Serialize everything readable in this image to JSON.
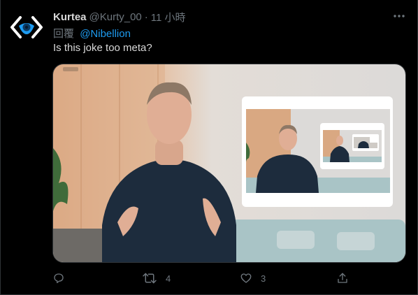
{
  "tweet": {
    "author_name": "Kurtea",
    "author_handle": "@Kurty_00",
    "separator": "·",
    "timestamp": "11 小時",
    "reply_prefix": "回覆",
    "reply_to": "@Nibellion",
    "text": "Is this joke too meta?",
    "media_icon": "recursive-video-frame-image"
  },
  "actions": {
    "reply_icon": "reply-icon",
    "retweet_icon": "retweet-icon",
    "retweet_count": "4",
    "like_icon": "heart-icon",
    "like_count": "3",
    "share_icon": "share-icon"
  },
  "colors": {
    "background": "#000000",
    "primary_text": "#d9d9d9",
    "secondary_text": "#6e767d",
    "link": "#1d9bf0",
    "avatar_accent": "#1d9bf0"
  }
}
